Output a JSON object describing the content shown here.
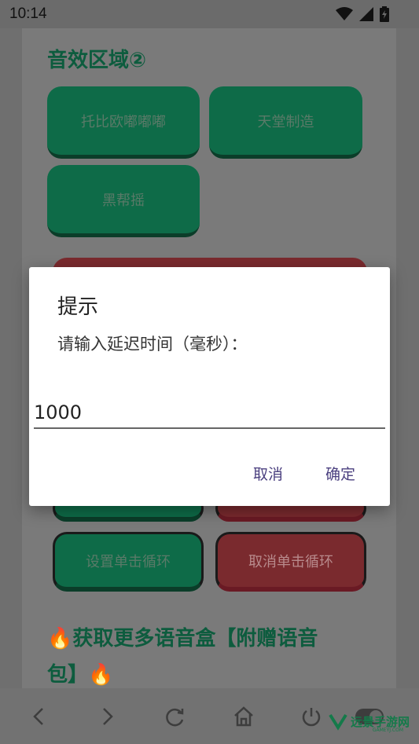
{
  "status_bar": {
    "time": "10:14"
  },
  "section": {
    "title": "音效区域②"
  },
  "buttons": {
    "b1": "托比欧嘟嘟嘟",
    "b2": "天堂制造",
    "b3": "黑帮摇",
    "set_loop": "设置单击循环",
    "cancel_loop": "取消单击循环"
  },
  "promo": {
    "line1": "🔥获取更多语音盒【附赠语音",
    "line2": "包】🔥"
  },
  "dialog": {
    "title": "提示",
    "message": "请输入延迟时间（毫秒）：",
    "input_value": "1000",
    "cancel_label": "取消",
    "confirm_label": "确定"
  },
  "watermark": {
    "text": "远景手游网",
    "sub": "GAMEYJ.COM"
  },
  "colors": {
    "accent_green": "#0e6b48",
    "accent_red": "#7a2a2e",
    "dialog_button": "#4a3f7f"
  },
  "icons": [
    "wifi-icon",
    "signal-icon",
    "battery-icon",
    "back-icon",
    "forward-icon",
    "refresh-icon",
    "home-icon",
    "power-icon",
    "toggle-icon"
  ]
}
